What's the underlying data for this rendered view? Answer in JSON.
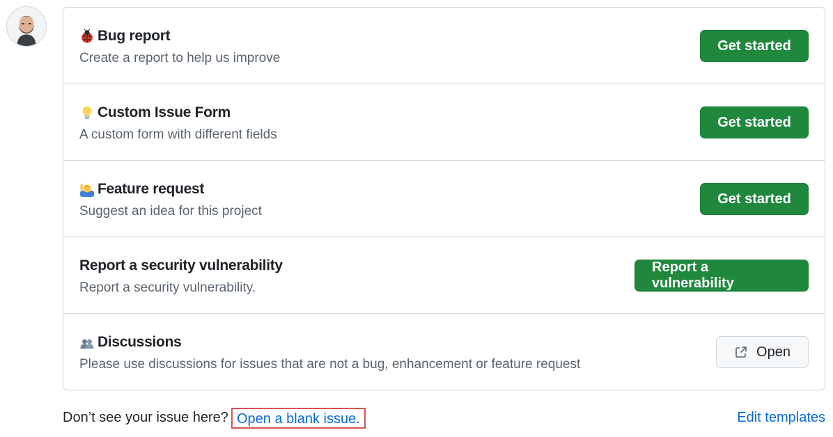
{
  "templates": [
    {
      "icon": "ladybug-icon",
      "title": "Bug report",
      "description": "Create a report to help us improve",
      "button": "Get started"
    },
    {
      "icon": "lightbulb-icon",
      "title": "Custom Issue Form",
      "description": "A custom form with different fields",
      "button": "Get started"
    },
    {
      "icon": "person-raising-hand-icon",
      "title": "Feature request",
      "description": "Suggest an idea for this project",
      "button": "Get started"
    },
    {
      "icon": "",
      "title": "Report a security vulnerability",
      "description": "Report a security vulnerability.",
      "button": "Report a vulnerability"
    },
    {
      "icon": "people-icon",
      "title": "Discussions",
      "description": "Please use discussions for issues that are not a bug, enhancement or feature request",
      "button": "Open"
    }
  ],
  "footer": {
    "prompt": "Don’t see your issue here?",
    "blank_issue_link": "Open a blank issue.",
    "edit_templates_link": "Edit templates"
  },
  "colors": {
    "primary_button": "#1f883d",
    "link": "#0969da",
    "highlight_box": "#d9534f"
  }
}
